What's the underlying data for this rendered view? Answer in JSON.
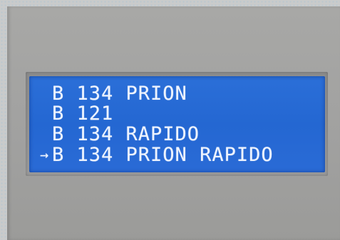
{
  "display": {
    "lines": [
      {
        "cursor": "",
        "text": "B 134 PRION"
      },
      {
        "cursor": "",
        "text": "B 121"
      },
      {
        "cursor": "",
        "text": "B 134 RAPIDO"
      },
      {
        "cursor": "→",
        "text": "B 134 PRION RAPIDO"
      }
    ]
  },
  "colors": {
    "lcd_background": "#2467d2",
    "lcd_text": "#eef4ff",
    "housing": "#a3a3a1"
  }
}
